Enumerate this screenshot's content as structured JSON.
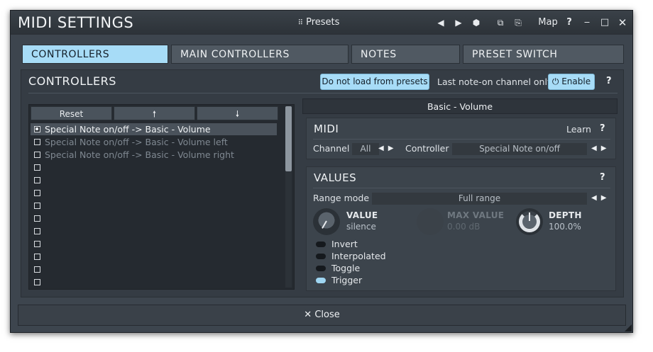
{
  "window": {
    "title": "MIDI SETTINGS",
    "presets_label": "Presets",
    "map_label": "Map",
    "help_label": "?",
    "minimize_label": "‒",
    "maximize_label": "□",
    "close_label": "✕",
    "prev_label": "◀",
    "next_label": "▶",
    "random_label": "⬢",
    "copy_label": "⧉",
    "paste_label": "⎘"
  },
  "tabs": [
    {
      "label": "CONTROLLERS",
      "active": true
    },
    {
      "label": "MAIN CONTROLLERS",
      "active": false
    },
    {
      "label": "NOTES",
      "active": false
    },
    {
      "label": "PRESET SWITCH",
      "active": false
    }
  ],
  "controllers": {
    "title": "CONTROLLERS",
    "do_not_load_label": "Do not load from presets",
    "last_note_label": "Last note-on channel only",
    "enable_label": "Enable",
    "enable_icon": "⏻",
    "help_label": "?",
    "list": {
      "reset_label": "Reset",
      "up_label": "🠕",
      "down_label": "🠗",
      "rows": [
        {
          "label": "Special Note on/off -> Basic - Volume",
          "checked": true,
          "selected": true
        },
        {
          "label": "Special Note on/off -> Basic - Volume left",
          "checked": false,
          "selected": false
        },
        {
          "label": "Special Note on/off -> Basic - Volume right",
          "checked": false,
          "selected": false
        },
        {
          "label": "",
          "checked": false,
          "selected": false
        },
        {
          "label": "",
          "checked": false,
          "selected": false
        },
        {
          "label": "",
          "checked": false,
          "selected": false
        },
        {
          "label": "",
          "checked": false,
          "selected": false
        },
        {
          "label": "",
          "checked": false,
          "selected": false
        },
        {
          "label": "",
          "checked": false,
          "selected": false
        },
        {
          "label": "",
          "checked": false,
          "selected": false
        },
        {
          "label": "",
          "checked": false,
          "selected": false
        },
        {
          "label": "",
          "checked": false,
          "selected": false
        },
        {
          "label": "",
          "checked": false,
          "selected": false
        }
      ]
    },
    "target_header": "Basic - Volume",
    "midi": {
      "title": "MIDI",
      "learn_label": "Learn",
      "help_label": "?",
      "channel_label": "Channel",
      "channel_value": "All",
      "controller_label": "Controller",
      "controller_value": "Special Note on/off",
      "arrows": "◀▶"
    },
    "values": {
      "title": "VALUES",
      "help_label": "?",
      "range_mode_label": "Range mode",
      "range_mode_value": "Full range",
      "arrows": "◀▶",
      "value_knob": {
        "name": "VALUE",
        "value": "silence"
      },
      "max_value_knob": {
        "name": "MAX VALUE",
        "value": "0.00 dB"
      },
      "depth_knob": {
        "name": "DEPTH",
        "value": "100.0%"
      },
      "toggles": [
        {
          "label": "Invert",
          "on": false
        },
        {
          "label": "Interpolated",
          "on": false
        },
        {
          "label": "Toggle",
          "on": false
        },
        {
          "label": "Trigger",
          "on": true
        }
      ]
    }
  },
  "close_button": {
    "icon": "✕",
    "label": "Close"
  },
  "colors": {
    "accent": "#a7dcf7",
    "background": "#3d454e",
    "panel": "#353c44",
    "list_bg": "#252a30"
  }
}
